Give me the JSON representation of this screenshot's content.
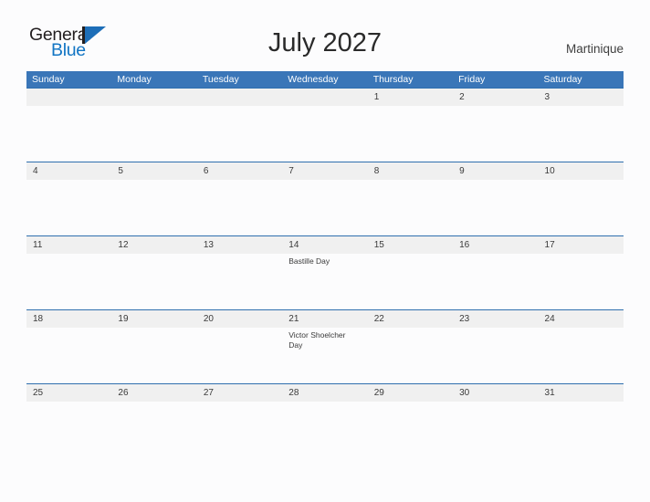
{
  "brand": {
    "name_part1": "General",
    "name_part2": "Blue",
    "flag_color": "#1d6eb8",
    "text_color": "#231f20",
    "blue_text_color": "#1275c4"
  },
  "header": {
    "title": "July 2027",
    "locale": "Martinique"
  },
  "theme": {
    "header_blue": "#3a76b8",
    "row_divider_blue": "#2f6fae",
    "date_strip_gray": "#f0f0f0",
    "page_background": "#fcfcfd"
  },
  "calendar": {
    "weekdays": [
      "Sunday",
      "Monday",
      "Tuesday",
      "Wednesday",
      "Thursday",
      "Friday",
      "Saturday"
    ],
    "weeks": [
      {
        "days": [
          {
            "num": "",
            "event": ""
          },
          {
            "num": "",
            "event": ""
          },
          {
            "num": "",
            "event": ""
          },
          {
            "num": "",
            "event": ""
          },
          {
            "num": "1",
            "event": ""
          },
          {
            "num": "2",
            "event": ""
          },
          {
            "num": "3",
            "event": ""
          }
        ]
      },
      {
        "days": [
          {
            "num": "4",
            "event": ""
          },
          {
            "num": "5",
            "event": ""
          },
          {
            "num": "6",
            "event": ""
          },
          {
            "num": "7",
            "event": ""
          },
          {
            "num": "8",
            "event": ""
          },
          {
            "num": "9",
            "event": ""
          },
          {
            "num": "10",
            "event": ""
          }
        ]
      },
      {
        "days": [
          {
            "num": "11",
            "event": ""
          },
          {
            "num": "12",
            "event": ""
          },
          {
            "num": "13",
            "event": ""
          },
          {
            "num": "14",
            "event": "Bastille Day"
          },
          {
            "num": "15",
            "event": ""
          },
          {
            "num": "16",
            "event": ""
          },
          {
            "num": "17",
            "event": ""
          }
        ]
      },
      {
        "days": [
          {
            "num": "18",
            "event": ""
          },
          {
            "num": "19",
            "event": ""
          },
          {
            "num": "20",
            "event": ""
          },
          {
            "num": "21",
            "event": "Victor Shoelcher Day"
          },
          {
            "num": "22",
            "event": ""
          },
          {
            "num": "23",
            "event": ""
          },
          {
            "num": "24",
            "event": ""
          }
        ]
      },
      {
        "days": [
          {
            "num": "25",
            "event": ""
          },
          {
            "num": "26",
            "event": ""
          },
          {
            "num": "27",
            "event": ""
          },
          {
            "num": "28",
            "event": ""
          },
          {
            "num": "29",
            "event": ""
          },
          {
            "num": "30",
            "event": ""
          },
          {
            "num": "31",
            "event": ""
          }
        ]
      }
    ]
  }
}
